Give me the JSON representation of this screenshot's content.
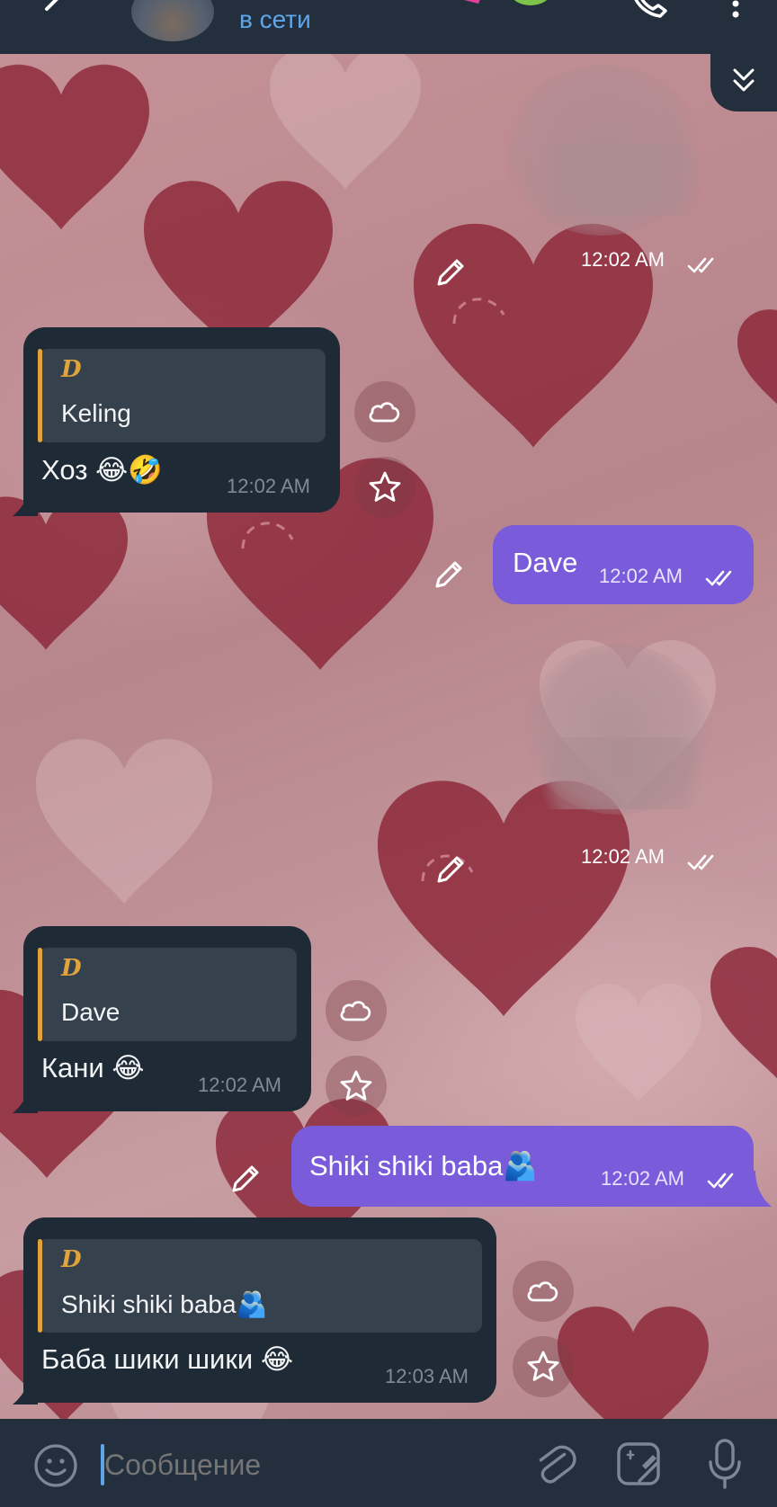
{
  "header": {
    "status": "в сети",
    "colors": {
      "background": "#242f3d",
      "status": "#5fa6e8"
    }
  },
  "messages": [
    {
      "type": "media-out",
      "time": "12:02 AM"
    },
    {
      "type": "in",
      "reply_author": "D",
      "reply_text": "Keling",
      "text": "Хоз 😂🤣",
      "time": "12:02 AM"
    },
    {
      "type": "out",
      "text": "Dave",
      "time": "12:02 AM"
    },
    {
      "type": "media-out",
      "time": "12:02 AM"
    },
    {
      "type": "in",
      "reply_author": "D",
      "reply_text": "Dave",
      "text": "Кани 😂",
      "time": "12:02 AM"
    },
    {
      "type": "out",
      "text": "Shiki shiki baba🫂",
      "time": "12:02 AM"
    },
    {
      "type": "in",
      "reply_author": "D",
      "reply_text": "Shiki shiki baba🫂",
      "text": "Баба шики шики 😂",
      "time": "12:03 AM"
    }
  ],
  "composer": {
    "placeholder": "Сообщение"
  },
  "icons": {
    "header": [
      "back-arrow-icon",
      "avatar",
      "call-icon",
      "more-icon"
    ],
    "side": [
      "edit-icon",
      "cloud-icon",
      "star-icon"
    ],
    "composer": [
      "emoji-icon",
      "attach-icon",
      "sticker-icon",
      "mic-icon"
    ]
  },
  "colors": {
    "bubble_in": "#1e2a35",
    "bubble_out": "#7a5bd9",
    "reply_accent": "#e1a33c",
    "input_bar": "#242f3d"
  }
}
